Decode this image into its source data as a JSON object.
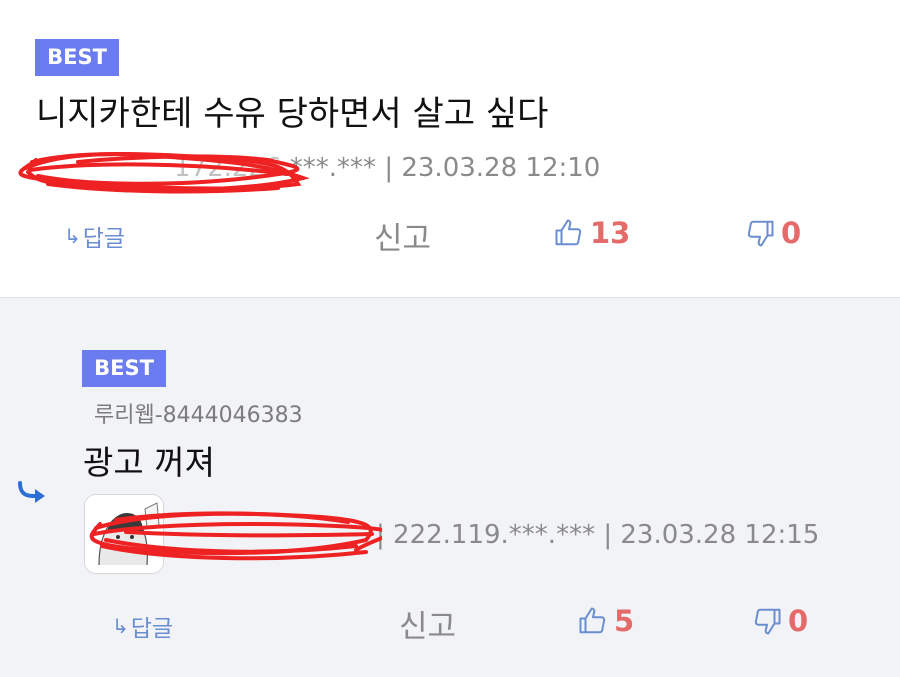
{
  "comments": [
    {
      "badge": "BEST",
      "body": "니지카한테 수유 당하면서 살고 싶다",
      "meta_redacted": "172.226",
      "meta": ".***.*** | 23.03.28 12:10",
      "actions": {
        "reply_arrow": "↳",
        "reply_label": "답글",
        "report_label": "신고",
        "upvotes": "13",
        "downvotes": "0"
      }
    },
    {
      "badge": "BEST",
      "author": "루리웹-8444046383",
      "body": "광고 꺼져",
      "meta": "| 222.119.***.*** | 23.03.28 12:15",
      "actions": {
        "reply_arrow": "↳",
        "reply_label": "답글",
        "report_label": "신고",
        "upvotes": "5",
        "downvotes": "0"
      }
    }
  ],
  "colors": {
    "badge": "#6b7cf0",
    "vote_count": "#e56a6a",
    "link_blue": "#6b8ed0",
    "scribble_red": "#ee2222",
    "reply_bg": "#f2f3f6"
  },
  "icons": {
    "upvote": "thumbs-up-icon",
    "downvote": "thumbs-down-icon",
    "reply_indicator": "reply-arrow-icon"
  }
}
